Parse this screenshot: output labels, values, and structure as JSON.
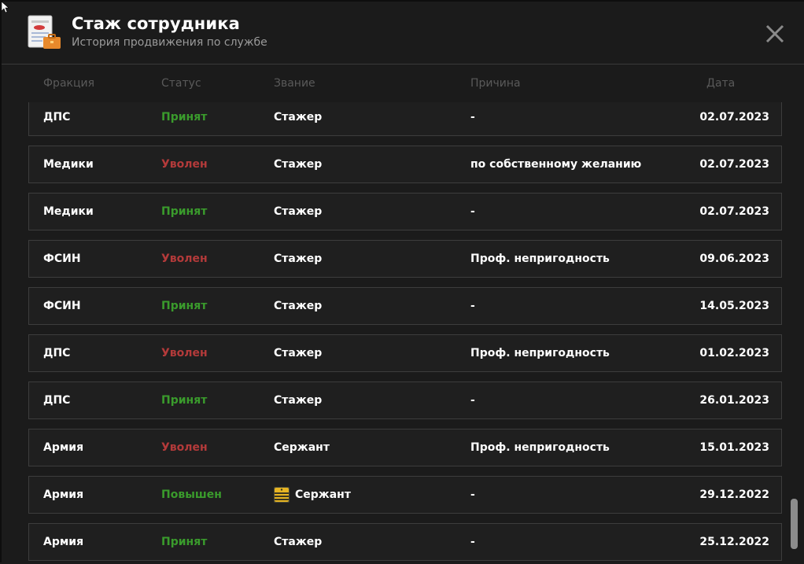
{
  "header": {
    "title": "Стаж сотрудника",
    "subtitle": "История продвижения по службе"
  },
  "columns": {
    "faction": "Фракция",
    "status": "Статус",
    "rank": "Звание",
    "reason": "Причина",
    "date": "Дата"
  },
  "colors": {
    "accepted": "#3a9b2c",
    "dismissed": "#b33a3a",
    "rank_badge": "#e6b422"
  },
  "rows": [
    {
      "faction": "ДПС",
      "status": "Принят",
      "status_type": "green",
      "rank": "Стажер",
      "rank_icon": "",
      "reason": "-",
      "date": "02.07.2023"
    },
    {
      "faction": "Медики",
      "status": "Уволен",
      "status_type": "red",
      "rank": "Стажер",
      "rank_icon": "",
      "reason": "по собственному желанию",
      "date": "02.07.2023"
    },
    {
      "faction": "Медики",
      "status": "Принят",
      "status_type": "green",
      "rank": "Стажер",
      "rank_icon": "",
      "reason": "-",
      "date": "02.07.2023"
    },
    {
      "faction": "ФСИН",
      "status": "Уволен",
      "status_type": "red",
      "rank": "Стажер",
      "rank_icon": "",
      "reason": "Проф. непригодность",
      "date": "09.06.2023"
    },
    {
      "faction": "ФСИН",
      "status": "Принят",
      "status_type": "green",
      "rank": "Стажер",
      "rank_icon": "",
      "reason": "-",
      "date": "14.05.2023"
    },
    {
      "faction": "ДПС",
      "status": "Уволен",
      "status_type": "red",
      "rank": "Стажер",
      "rank_icon": "",
      "reason": "Проф. непригодность",
      "date": "01.02.2023"
    },
    {
      "faction": "ДПС",
      "status": "Принят",
      "status_type": "green",
      "rank": "Стажер",
      "rank_icon": "",
      "reason": "-",
      "date": "26.01.2023"
    },
    {
      "faction": "Армия",
      "status": "Уволен",
      "status_type": "red",
      "rank": "Сержант",
      "rank_icon": "",
      "reason": "Проф. непригодность",
      "date": "15.01.2023"
    },
    {
      "faction": "Армия",
      "status": "Повышен",
      "status_type": "green",
      "rank": "Сержант",
      "rank_icon": "sergeant-rank-badge-icon",
      "reason": "-",
      "date": "29.12.2022"
    },
    {
      "faction": "Армия",
      "status": "Принят",
      "status_type": "green",
      "rank": "Стажер",
      "rank_icon": "",
      "reason": "-",
      "date": "25.12.2022"
    }
  ],
  "scroll": {
    "position": 1.0
  }
}
